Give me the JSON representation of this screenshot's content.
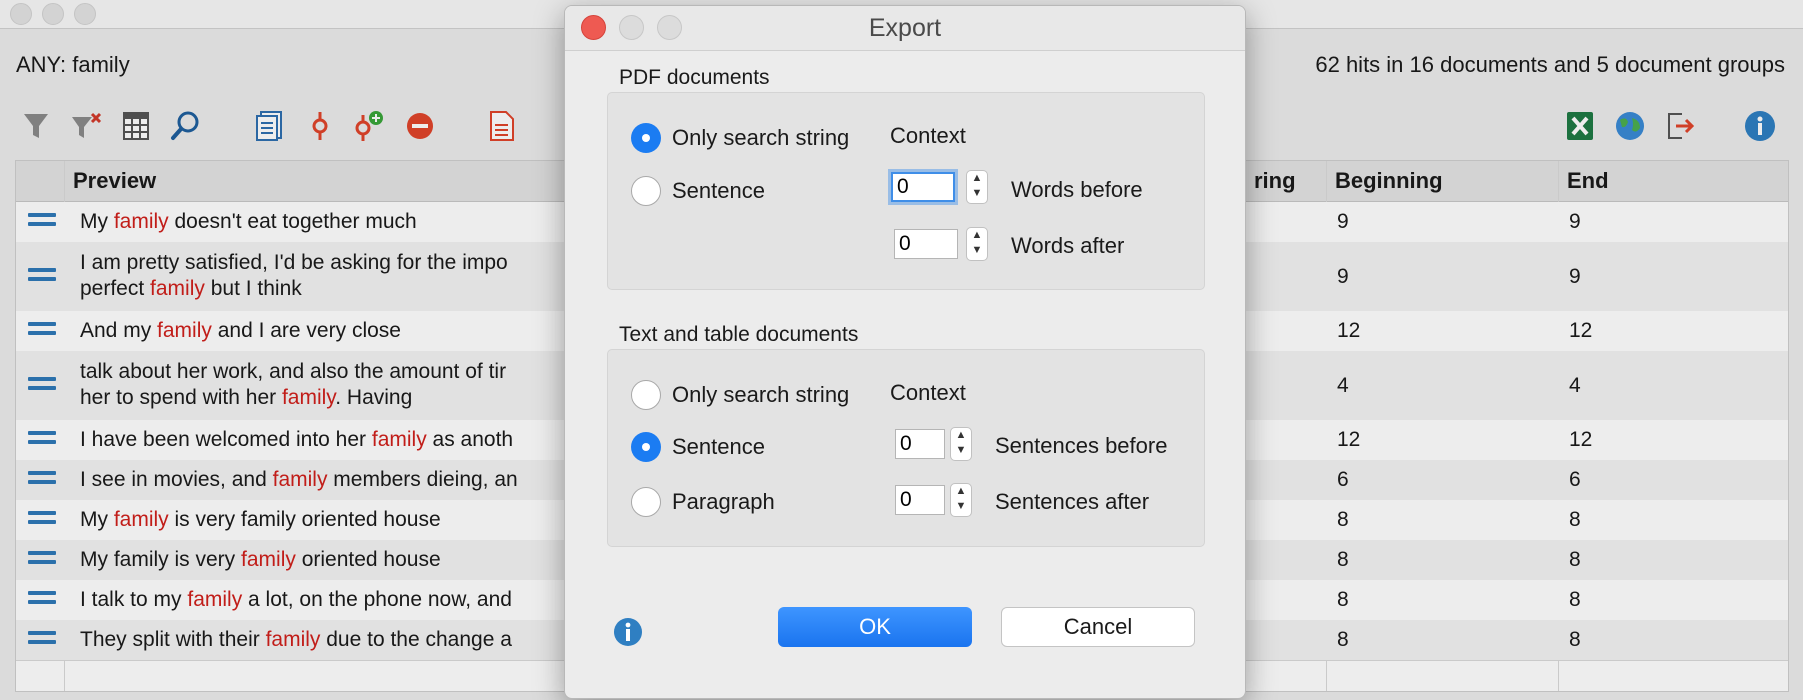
{
  "main": {
    "query": "ANY: family",
    "hits": "62 hits in 16 documents and 5 document groups",
    "toolbar_left_icons": [
      "filter-icon",
      "clear-filter-icon",
      "table-columns-icon",
      "search-icon",
      "document-list-icon",
      "code-icon",
      "add-code-icon",
      "remove-icon",
      "pdf-icon"
    ],
    "toolbar_right_icons": [
      "excel-icon",
      "globe-icon",
      "exit-icon",
      "info-icon"
    ],
    "columns": {
      "preview": "Preview",
      "string_partial": "ring",
      "beginning": "Beginning",
      "end": "End"
    },
    "rows": [
      {
        "pre": "My ",
        "hit": "family",
        "post": " doesn't eat together much",
        "line2": "",
        "beginning": "9",
        "end": "9"
      },
      {
        "pre": "I am pretty satisfied, I'd be asking for the impo",
        "hit": "",
        "post": "",
        "line2_pre": "perfect ",
        "line2_hit": "family",
        "line2_post": " but I think",
        "beginning": "9",
        "end": "9"
      },
      {
        "pre": "And my ",
        "hit": "family",
        "post": " and I are very close",
        "beginning": "12",
        "end": "12"
      },
      {
        "pre": "talk about her work, and also the amount of tir",
        "hit": "",
        "post": "",
        "line2_pre": "her to spend with her ",
        "line2_hit": "family",
        "line2_post": ". Having",
        "beginning": "4",
        "end": "4"
      },
      {
        "pre": "I have been welcomed into her ",
        "hit": "family",
        "post": " as anoth",
        "beginning": "12",
        "end": "12"
      },
      {
        "pre": "I see in movies, and ",
        "hit": "family",
        "post": " members dieing, an",
        "beginning": "6",
        "end": "6"
      },
      {
        "pre": "My ",
        "hit": "family",
        "post": " is very family oriented house",
        "beginning": "8",
        "end": "8"
      },
      {
        "pre": "My family is very ",
        "hit": "family",
        "post": " oriented house",
        "beginning": "8",
        "end": "8"
      },
      {
        "pre": "I talk to my ",
        "hit": "family",
        "post": " a lot, on the phone now, and",
        "beginning": "8",
        "end": "8"
      },
      {
        "pre": "They split with their ",
        "hit": "family",
        "post": " due to the change a",
        "beginning": "8",
        "end": "8"
      }
    ]
  },
  "dialog": {
    "title": "Export",
    "pdf": {
      "section": "PDF documents",
      "option_only": "Only search string",
      "option_sentence": "Sentence",
      "selected": "only",
      "context_label": "Context",
      "words_before_value": "0",
      "words_before_label": "Words before",
      "words_after_value": "0",
      "words_after_label": "Words after"
    },
    "text": {
      "section": "Text and table documents",
      "option_only": "Only search string",
      "option_sentence": "Sentence",
      "option_paragraph": "Paragraph",
      "selected": "sentence",
      "context_label": "Context",
      "sentences_before_value": "0",
      "sentences_before_label": "Sentences before",
      "sentences_after_value": "0",
      "sentences_after_label": "Sentences after"
    },
    "ok_label": "OK",
    "cancel_label": "Cancel"
  },
  "colors": {
    "accent": "#1b7cf2",
    "highlight": "#d0201b",
    "handle": "#2f79b9"
  }
}
